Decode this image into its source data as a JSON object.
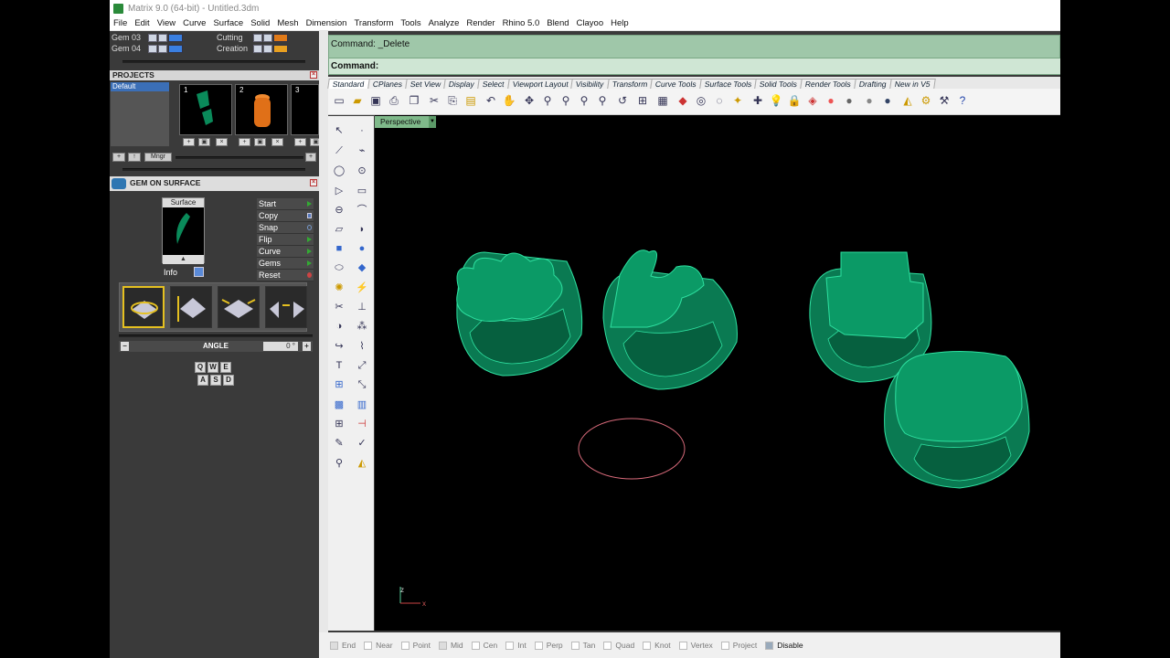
{
  "window": {
    "title": "Matrix 9.0 (64-bit) - Untitled.3dm"
  },
  "menu": [
    "File",
    "Edit",
    "View",
    "Curve",
    "Surface",
    "Solid",
    "Mesh",
    "Dimension",
    "Transform",
    "Tools",
    "Analyze",
    "Render",
    "Rhino 5.0",
    "Blend",
    "Clayoo",
    "Help"
  ],
  "layers": [
    {
      "name": "Gem 03",
      "color": "#3a7fe0"
    },
    {
      "name": "Gem 04",
      "color": "#3a7fe0"
    },
    {
      "name": "Cutting",
      "color": "#e07a18"
    },
    {
      "name": "Creation",
      "color": "#e8a020"
    }
  ],
  "projects": {
    "title": "PROJECTS",
    "default_label": "Default",
    "thumb_numbers": [
      "1",
      "2",
      "3"
    ],
    "manager_label": "Mngr"
  },
  "gem_on_surface": {
    "title": "GEM ON SURFACE",
    "surface_label": "Surface",
    "info_label": "Info",
    "menu_items": [
      "Start",
      "Copy",
      "Snap",
      "Flip",
      "Curve",
      "Gems",
      "Reset"
    ],
    "angle_label": "ANGLE",
    "angle_value": "0 °",
    "keys_row1": [
      "Q",
      "W",
      "E"
    ],
    "keys_row2": [
      "A",
      "S",
      "D"
    ]
  },
  "command": {
    "line1": "Command: _Delete",
    "line2": "Command:"
  },
  "tabs": [
    "Standard",
    "CPlanes",
    "Set View",
    "Display",
    "Select",
    "Viewport Layout",
    "Visibility",
    "Transform",
    "Curve Tools",
    "Surface Tools",
    "Solid Tools",
    "Render Tools",
    "Drafting",
    "New in V5"
  ],
  "viewport": {
    "label": "Perspective",
    "axis_z": "z",
    "axis_x": "x"
  },
  "osnaps": [
    {
      "label": "End",
      "checked": true
    },
    {
      "label": "Near",
      "checked": false
    },
    {
      "label": "Point",
      "checked": false
    },
    {
      "label": "Mid",
      "checked": true
    },
    {
      "label": "Cen",
      "checked": false
    },
    {
      "label": "Int",
      "checked": false
    },
    {
      "label": "Perp",
      "checked": false
    },
    {
      "label": "Tan",
      "checked": false
    },
    {
      "label": "Quad",
      "checked": false
    },
    {
      "label": "Knot",
      "checked": false
    },
    {
      "label": "Vertex",
      "checked": false
    },
    {
      "label": "Project",
      "checked": false
    },
    {
      "label": "Disable",
      "checked": true
    }
  ],
  "colors": {
    "ring": "#0a8a5a",
    "ring_edge": "#5de0a8",
    "circle": "#d86a7a",
    "command_bg": "#9fc7a9"
  }
}
